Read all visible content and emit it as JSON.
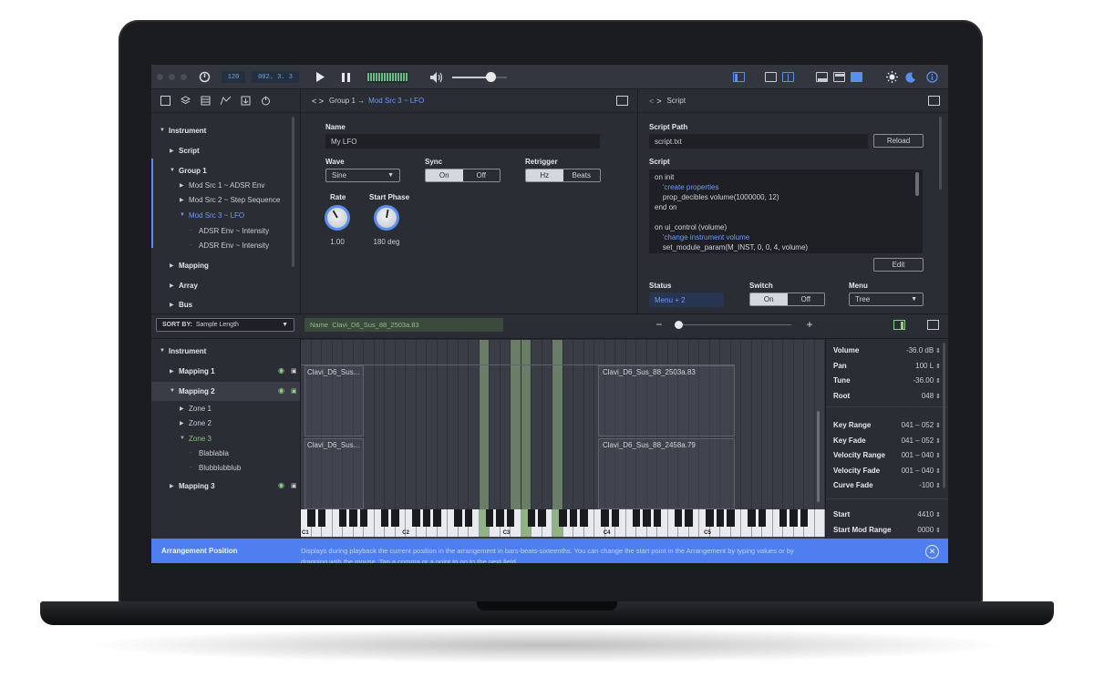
{
  "toolbar": {
    "tempo": "120",
    "position": "002. 3. 3",
    "play_icon": "play-icon",
    "pause_icon": "pause-icon",
    "volume_icon": "speaker-icon"
  },
  "left_tree": {
    "items": [
      {
        "label": "Instrument",
        "level": 0,
        "state": "expanded"
      },
      {
        "label": "Script",
        "level": 1,
        "state": "collapsed"
      },
      {
        "label": "Group 1",
        "level": 1,
        "state": "expanded"
      },
      {
        "label": "Mod Src 1 ~ ADSR Env",
        "level": 2,
        "state": "collapsed"
      },
      {
        "label": "Mod Src 2 ~ Step Sequence",
        "level": 2,
        "state": "collapsed"
      },
      {
        "label": "Mod Src 3 ~ LFO",
        "level": 2,
        "state": "active"
      },
      {
        "label": "ADSR Env ~ Intensity",
        "level": 3,
        "state": "leaf"
      },
      {
        "label": "ADSR Env ~ Intensity",
        "level": 3,
        "state": "leaf"
      },
      {
        "label": "Mapping",
        "level": 1,
        "state": "collapsed"
      },
      {
        "label": "Array",
        "level": 1,
        "state": "collapsed"
      },
      {
        "label": "Bus",
        "level": 1,
        "state": "collapsed"
      }
    ]
  },
  "center": {
    "breadcrumb_prefix": "Group 1 →",
    "breadcrumb_active": "Mod Src 3 ~ LFO",
    "name_label": "Name",
    "name_value": "My LFO",
    "wave_label": "Wave",
    "wave_value": "Sine",
    "sync_label": "Sync",
    "sync_on": "On",
    "sync_off": "Off",
    "retrigger_label": "Retrigger",
    "retrigger_hz": "Hz",
    "retrigger_beats": "Beats",
    "rate_label": "Rate",
    "rate_value": "1.00",
    "phase_label": "Start Phase",
    "phase_value": "180 deg"
  },
  "script_panel": {
    "title": "Script",
    "path_label": "Script Path",
    "path_value": "script.txt",
    "reload": "Reload",
    "script_label": "Script",
    "code": [
      {
        "text": "on init",
        "comment": false
      },
      {
        "text": "    'create properties",
        "comment": true
      },
      {
        "text": "    prop_decibles volume(1000000, 12)",
        "comment": false
      },
      {
        "text": "end on",
        "comment": false
      },
      {
        "text": "",
        "comment": false
      },
      {
        "text": "on ui_control (volume)",
        "comment": false
      },
      {
        "text": "    'change instrument volume",
        "comment": true
      },
      {
        "text": "    set_module_param(M_INST, 0, 0, 4, volume)",
        "comment": false
      }
    ],
    "edit": "Edit",
    "status_label": "Status",
    "status_value": "Menu + 2",
    "switch_label": "Switch",
    "switch_on": "On",
    "switch_off": "Off",
    "menu_label": "Menu",
    "menu_value": "Tree"
  },
  "mapping": {
    "sort_label": "SORT BY:",
    "sort_value": "Sample Length",
    "name_field_label": "Name",
    "name_field_value": "Clavi_D6_Sus_88_2503a.83",
    "tree": [
      {
        "label": "Instrument",
        "level": 0,
        "state": "expanded"
      },
      {
        "label": "Mapping 1",
        "level": 1,
        "state": "collapsed",
        "icons": true
      },
      {
        "label": "Mapping 2",
        "level": 1,
        "state": "expanded",
        "icons": true
      },
      {
        "label": "Zone 1",
        "level": 2,
        "state": "collapsed"
      },
      {
        "label": "Zone 2",
        "level": 2,
        "state": "collapsed"
      },
      {
        "label": "Zone 3",
        "level": 2,
        "state": "active"
      },
      {
        "label": "Blablabla",
        "level": 3,
        "state": "leaf"
      },
      {
        "label": "Blubblubblub",
        "level": 3,
        "state": "leaf"
      },
      {
        "label": "Mapping 3",
        "level": 1,
        "state": "collapsed",
        "icons": true
      }
    ],
    "zones": [
      {
        "label": "Clavi_D6_Sus..."
      },
      {
        "label": "Clavi_D6_Sus_88_2503a.83"
      },
      {
        "label": "Clavi_D6_Sus..."
      },
      {
        "label": "Clavi_D6_Sus_88_2458a.79"
      }
    ],
    "octave_labels": [
      "C1",
      "C2",
      "C3",
      "C4",
      "C5"
    ]
  },
  "properties": {
    "group1": [
      {
        "k": "Volume",
        "v": "-36.0 dB"
      },
      {
        "k": "Pan",
        "v": "100 L"
      },
      {
        "k": "Tune",
        "v": "-36.00"
      },
      {
        "k": "Root",
        "v": "048"
      }
    ],
    "group2": [
      {
        "k": "Key Range",
        "v": "041 – 052"
      },
      {
        "k": "Key Fade",
        "v": "041 – 052"
      },
      {
        "k": "Velocity Range",
        "v": "001 – 040"
      },
      {
        "k": "Velocity Fade",
        "v": "001 – 040"
      },
      {
        "k": "Curve Fade",
        "v": "-100"
      }
    ],
    "group3": [
      {
        "k": "Start",
        "v": "4410"
      },
      {
        "k": "Start Mod Range",
        "v": "0000"
      }
    ]
  },
  "info_bar": {
    "title": "Arrangement Position",
    "text": "Displays during playback the current position in the arrangement in bars-beats-sixteenths. You can change the start point in the Arrangement by typing values or by dragging with the mouse. Tap a comma or a point to go to the next field."
  },
  "colors": {
    "accent": "#5a8ff0",
    "info_bar": "#4e7ef0",
    "highlight_key": "#8fb383"
  }
}
